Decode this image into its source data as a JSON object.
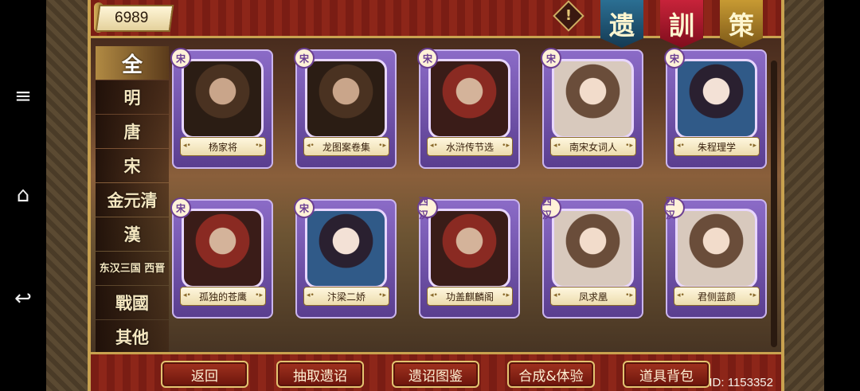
{
  "android_nav": {
    "menu_icon": "menu-icon",
    "home_icon": "home-icon",
    "back_icon": "back-icon"
  },
  "header": {
    "currency_value": "6989",
    "warning_symbol": "!",
    "banners": [
      "遗",
      "訓",
      "策"
    ]
  },
  "tabs": [
    "全",
    "明",
    "唐",
    "宋",
    "金元清",
    "漢",
    "东汉三国 西晋",
    "戰國",
    "其他"
  ],
  "cards": [
    {
      "name": "杨家将",
      "dynasty": "宋"
    },
    {
      "name": "龙图案卷集",
      "dynasty": "宋"
    },
    {
      "name": "水浒传节选",
      "dynasty": "宋"
    },
    {
      "name": "南宋女词人",
      "dynasty": "宋"
    },
    {
      "name": "朱程理学",
      "dynasty": "宋"
    },
    {
      "name": "孤独的苍鹰",
      "dynasty": "宋"
    },
    {
      "name": "汴梁二娇",
      "dynasty": "宋"
    },
    {
      "name": "功盖麒麟阁",
      "dynasty": "西汉"
    },
    {
      "name": "凤求凰",
      "dynasty": "西汉"
    },
    {
      "name": "君侧蓝颜",
      "dynasty": "西汉"
    }
  ],
  "buttons": {
    "back": "返回",
    "draw": "抽取遗诏",
    "atlas": "遗诏图鉴",
    "compose": "合成&体验",
    "bag": "道具背包"
  },
  "footer": {
    "user_id": "ID: 1153352"
  }
}
